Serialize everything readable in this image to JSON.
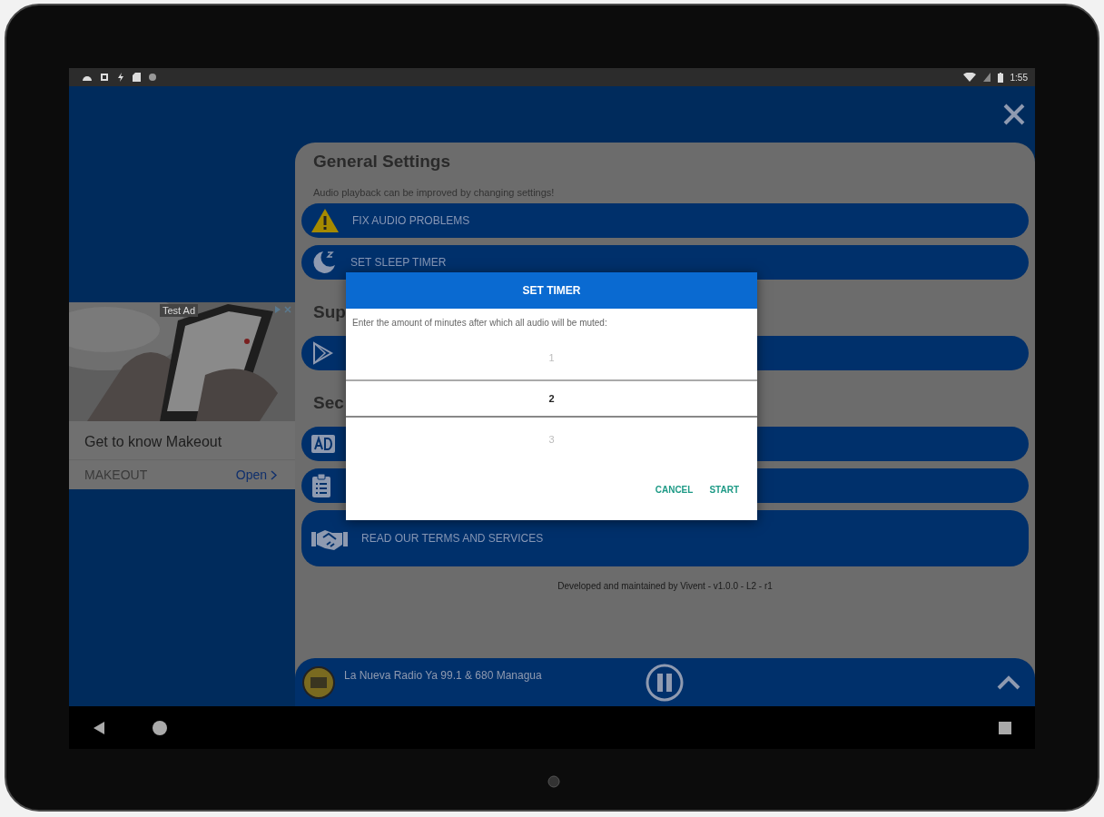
{
  "status_bar": {
    "time": "1:55"
  },
  "ad": {
    "badge": "Test Ad",
    "headline": "Get to know Makeout",
    "advertiser": "MAKEOUT",
    "cta": "Open"
  },
  "settings": {
    "title": "General Settings",
    "items": [
      {
        "kind": "note",
        "text": "Audio playback can be improved by changing settings!"
      },
      {
        "kind": "button",
        "label": "FIX AUDIO PROBLEMS"
      },
      {
        "kind": "button",
        "label": "SET SLEEP TIMER"
      },
      {
        "kind": "heading",
        "text": "Sup"
      },
      {
        "kind": "button"
      },
      {
        "kind": "heading",
        "text": "Sec"
      },
      {
        "kind": "button"
      },
      {
        "kind": "button"
      },
      {
        "kind": "button",
        "label": "READ OUR TERMS AND SERVICES",
        "tall": true
      }
    ],
    "footer": "Developed and maintained by Vivent - v1.0.0 - L2 - r1"
  },
  "player": {
    "station": "La Nueva Radio Ya 99.1 & 680 Managua",
    "playing": true
  },
  "dialog": {
    "title": "SET TIMER",
    "message": "Enter the amount of minutes after which all audio will be muted:",
    "options": [
      {
        "label": "1",
        "selected": false
      },
      {
        "label": "2",
        "selected": true
      },
      {
        "label": "3",
        "selected": false
      }
    ],
    "buttons": [
      "CANCEL",
      "START"
    ]
  }
}
